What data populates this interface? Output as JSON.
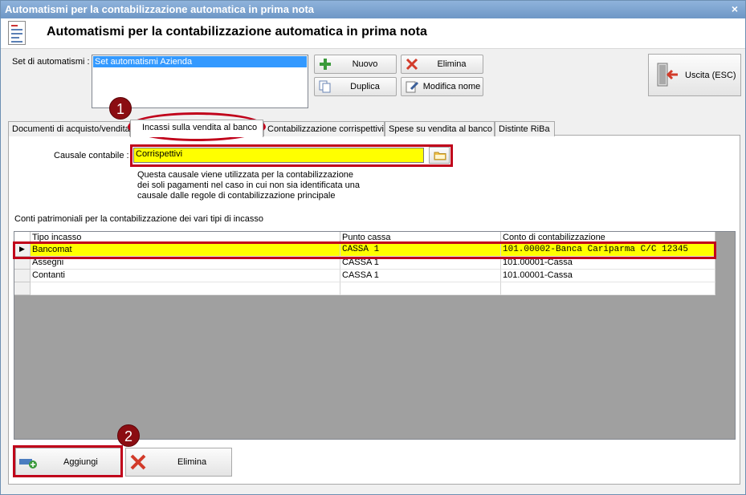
{
  "window": {
    "title": "Automatismi per la contabilizzazione automatica in prima nota",
    "close_glyph": "×"
  },
  "header": {
    "title": "Automatismi per la contabilizzazione automatica in prima nota",
    "icon": "document-icon"
  },
  "automation_set": {
    "label": "Set di automatismi :",
    "items": [
      "Set automatismi Azienda"
    ]
  },
  "toolbar": {
    "new_label": "Nuovo",
    "delete_label": "Elimina",
    "duplicate_label": "Duplica",
    "rename_label": "Modifica nome",
    "exit_label": "Uscita (ESC)"
  },
  "tabs": [
    {
      "label": "Documenti di acquisto/vendita"
    },
    {
      "label": "Incassi sulla vendita al banco",
      "active": true
    },
    {
      "label": "Contabilizzazione corrispettivi"
    },
    {
      "label": "Spese su vendita al banco"
    },
    {
      "label": "Distinte RiBa"
    }
  ],
  "causale": {
    "label": "Causale contabile :",
    "value": "Corrispettivi",
    "description_lines": [
      "Questa causale viene utilizzata per la contabilizzazione",
      "dei soli pagamenti nel caso in cui non sia identificata una",
      "causale dalle regole di contabilizzazione principale"
    ]
  },
  "grid": {
    "caption": "Conti patrimoniali per la contabilizzazione dei vari tipi di incasso",
    "columns": [
      "Tipo incasso",
      "Punto cassa",
      "Conto di contabilizzazione"
    ],
    "rows": [
      [
        "Bancomat",
        "CASSA 1",
        "101.00002-Banca Cariparma C/C 12345"
      ],
      [
        "Assegni",
        "CASSA 1",
        "101.00001-Cassa"
      ],
      [
        "Contanti",
        "CASSA 1",
        "101.00001-Cassa"
      ]
    ],
    "selected_row": 0,
    "row_indicator": "▶"
  },
  "bottom": {
    "add_label": "Aggiungi",
    "delete_label": "Elimina"
  },
  "annotations": {
    "badge1": "1",
    "badge2": "2"
  },
  "colors": {
    "highlight": "#ffff00",
    "annotation_red": "#c0001a",
    "selection_blue": "#3399ff"
  }
}
